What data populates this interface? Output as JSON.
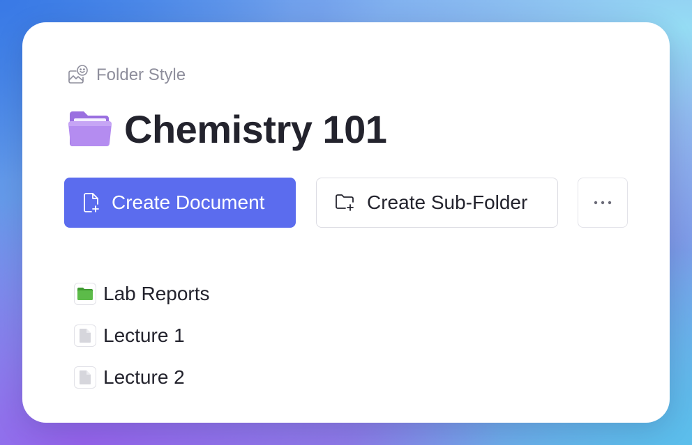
{
  "folder_style": {
    "label": "Folder Style",
    "icon": "image-smile-icon"
  },
  "header": {
    "title": "Chemistry 101",
    "folder_icon": "purple-open-folder-icon",
    "folder_color": "#b48cf0"
  },
  "actions": {
    "create_document": {
      "label": "Create Document",
      "icon": "file-plus-icon"
    },
    "create_subfolder": {
      "label": "Create Sub-Folder",
      "icon": "folder-plus-icon"
    },
    "more": {
      "icon": "more-horizontal-icon"
    }
  },
  "items": [
    {
      "name": "Lab Reports",
      "type": "folder",
      "icon": "green-folder-icon",
      "color": "#4fae3e"
    },
    {
      "name": "Lecture 1",
      "type": "document",
      "icon": "document-icon"
    },
    {
      "name": "Lecture 2",
      "type": "document",
      "icon": "document-icon"
    }
  ],
  "colors": {
    "primary": "#5b6cee",
    "text": "#23232d",
    "muted": "#8e8e9c"
  }
}
